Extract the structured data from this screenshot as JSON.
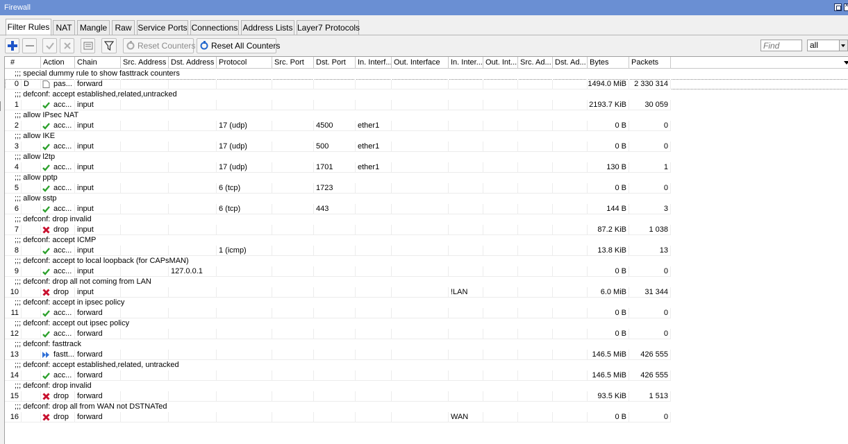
{
  "window": {
    "title": "Firewall"
  },
  "tabs": [
    "Filter Rules",
    "NAT",
    "Mangle",
    "Raw",
    "Service Ports",
    "Connections",
    "Address Lists",
    "Layer7 Protocols"
  ],
  "toolbar": {
    "reset_counters_label": "Reset Counters",
    "reset_all_counters_label": "Reset All Counters",
    "find_placeholder": "Find",
    "filter_value": "all"
  },
  "columns": [
    "#",
    "Action",
    "Chain",
    "Src. Address",
    "Dst. Address",
    "Protocol",
    "Src. Port",
    "Dst. Port",
    "In. Interf...",
    "Out. Interface",
    "In. Inter...",
    "Out. Int...",
    "Src. Ad...",
    "Dst. Ad...",
    "Bytes",
    "Packets"
  ],
  "rules": [
    {
      "comment": ";;; special dummy rule to show fasttrack counters",
      "num": "0",
      "flag": "D",
      "action": "pas...",
      "action_type": "passthrough",
      "chain": "forward",
      "src_address": "",
      "protocol": "",
      "dst_port": "",
      "in_interface": "",
      "in_interface_list": "",
      "bytes": "1494.0 MiB",
      "packets": "2 330 314"
    },
    {
      "comment": ";;; defconf: accept established,related,untracked",
      "num": "1",
      "flag": "",
      "action": "acc...",
      "action_type": "accept",
      "chain": "input",
      "src_address": "",
      "protocol": "",
      "dst_port": "",
      "in_interface": "",
      "in_interface_list": "",
      "bytes": "2193.7 KiB",
      "packets": "30 059"
    },
    {
      "comment": ";;; allow IPsec NAT",
      "num": "2",
      "flag": "",
      "action": "acc...",
      "action_type": "accept",
      "chain": "input",
      "src_address": "",
      "protocol": "17 (udp)",
      "dst_port": "4500",
      "in_interface": "ether1",
      "in_interface_list": "",
      "bytes": "0 B",
      "packets": "0"
    },
    {
      "comment": ";;; allow IKE",
      "num": "3",
      "flag": "",
      "action": "acc...",
      "action_type": "accept",
      "chain": "input",
      "src_address": "",
      "protocol": "17 (udp)",
      "dst_port": "500",
      "in_interface": "ether1",
      "in_interface_list": "",
      "bytes": "0 B",
      "packets": "0"
    },
    {
      "comment": ";;; allow l2tp",
      "num": "4",
      "flag": "",
      "action": "acc...",
      "action_type": "accept",
      "chain": "input",
      "src_address": "",
      "protocol": "17 (udp)",
      "dst_port": "1701",
      "in_interface": "ether1",
      "in_interface_list": "",
      "bytes": "130 B",
      "packets": "1"
    },
    {
      "comment": ";;; allow pptp",
      "num": "5",
      "flag": "",
      "action": "acc...",
      "action_type": "accept",
      "chain": "input",
      "src_address": "",
      "protocol": "6 (tcp)",
      "dst_port": "1723",
      "in_interface": "",
      "in_interface_list": "",
      "bytes": "0 B",
      "packets": "0"
    },
    {
      "comment": ";;; allow sstp",
      "num": "6",
      "flag": "",
      "action": "acc...",
      "action_type": "accept",
      "chain": "input",
      "src_address": "",
      "protocol": "6 (tcp)",
      "dst_port": "443",
      "in_interface": "",
      "in_interface_list": "",
      "bytes": "144 B",
      "packets": "3"
    },
    {
      "comment": ";;; defconf: drop invalid",
      "num": "7",
      "flag": "",
      "action": "drop",
      "action_type": "drop",
      "chain": "input",
      "src_address": "",
      "protocol": "",
      "dst_port": "",
      "in_interface": "",
      "in_interface_list": "",
      "bytes": "87.2 KiB",
      "packets": "1 038"
    },
    {
      "comment": ";;; defconf: accept ICMP",
      "num": "8",
      "flag": "",
      "action": "acc...",
      "action_type": "accept",
      "chain": "input",
      "src_address": "",
      "protocol": "1 (icmp)",
      "dst_port": "",
      "in_interface": "",
      "in_interface_list": "",
      "bytes": "13.8 KiB",
      "packets": "13"
    },
    {
      "comment": ";;; defconf: accept to local loopback (for CAPsMAN)",
      "num": "9",
      "flag": "",
      "action": "acc...",
      "action_type": "accept",
      "chain": "input",
      "src_address": "",
      "dst_address": "127.0.0.1",
      "protocol": "",
      "dst_port": "",
      "in_interface": "",
      "in_interface_list": "",
      "bytes": "0 B",
      "packets": "0"
    },
    {
      "comment": ";;; defconf: drop all not coming from LAN",
      "num": "10",
      "flag": "",
      "action": "drop",
      "action_type": "drop",
      "chain": "input",
      "src_address": "",
      "protocol": "",
      "dst_port": "",
      "in_interface": "",
      "in_interface_list": "!LAN",
      "bytes": "6.0 MiB",
      "packets": "31 344"
    },
    {
      "comment": ";;; defconf: accept in ipsec policy",
      "num": "11",
      "flag": "",
      "action": "acc...",
      "action_type": "accept",
      "chain": "forward",
      "src_address": "",
      "protocol": "",
      "dst_port": "",
      "in_interface": "",
      "in_interface_list": "",
      "bytes": "0 B",
      "packets": "0"
    },
    {
      "comment": ";;; defconf: accept out ipsec policy",
      "num": "12",
      "flag": "",
      "action": "acc...",
      "action_type": "accept",
      "chain": "forward",
      "src_address": "",
      "protocol": "",
      "dst_port": "",
      "in_interface": "",
      "in_interface_list": "",
      "bytes": "0 B",
      "packets": "0"
    },
    {
      "comment": ";;; defconf: fasttrack",
      "num": "13",
      "flag": "",
      "action": "fastt...",
      "action_type": "fasttrack",
      "chain": "forward",
      "src_address": "",
      "protocol": "",
      "dst_port": "",
      "in_interface": "",
      "in_interface_list": "",
      "bytes": "146.5 MiB",
      "packets": "426 555"
    },
    {
      "comment": ";;; defconf: accept established,related, untracked",
      "num": "14",
      "flag": "",
      "action": "acc...",
      "action_type": "accept",
      "chain": "forward",
      "src_address": "",
      "protocol": "",
      "dst_port": "",
      "in_interface": "",
      "in_interface_list": "",
      "bytes": "146.5 MiB",
      "packets": "426 555"
    },
    {
      "comment": ";;; defconf: drop invalid",
      "num": "15",
      "flag": "",
      "action": "drop",
      "action_type": "drop",
      "chain": "forward",
      "src_address": "",
      "protocol": "",
      "dst_port": "",
      "in_interface": "",
      "in_interface_list": "",
      "bytes": "93.5 KiB",
      "packets": "1 513"
    },
    {
      "comment": ";;; defconf: drop all from WAN not DSTNATed",
      "num": "16",
      "flag": "",
      "action": "drop",
      "action_type": "drop",
      "chain": "forward",
      "src_address": "",
      "protocol": "",
      "dst_port": "",
      "in_interface": "",
      "in_interface_list": "WAN",
      "bytes": "0 B",
      "packets": "0"
    }
  ],
  "colors": {
    "titlebar": "#6a8fd3",
    "accept": "#2ca02c",
    "drop": "#c8102e",
    "fasttrack": "#2f6fd6",
    "add": "#1e55c8"
  }
}
